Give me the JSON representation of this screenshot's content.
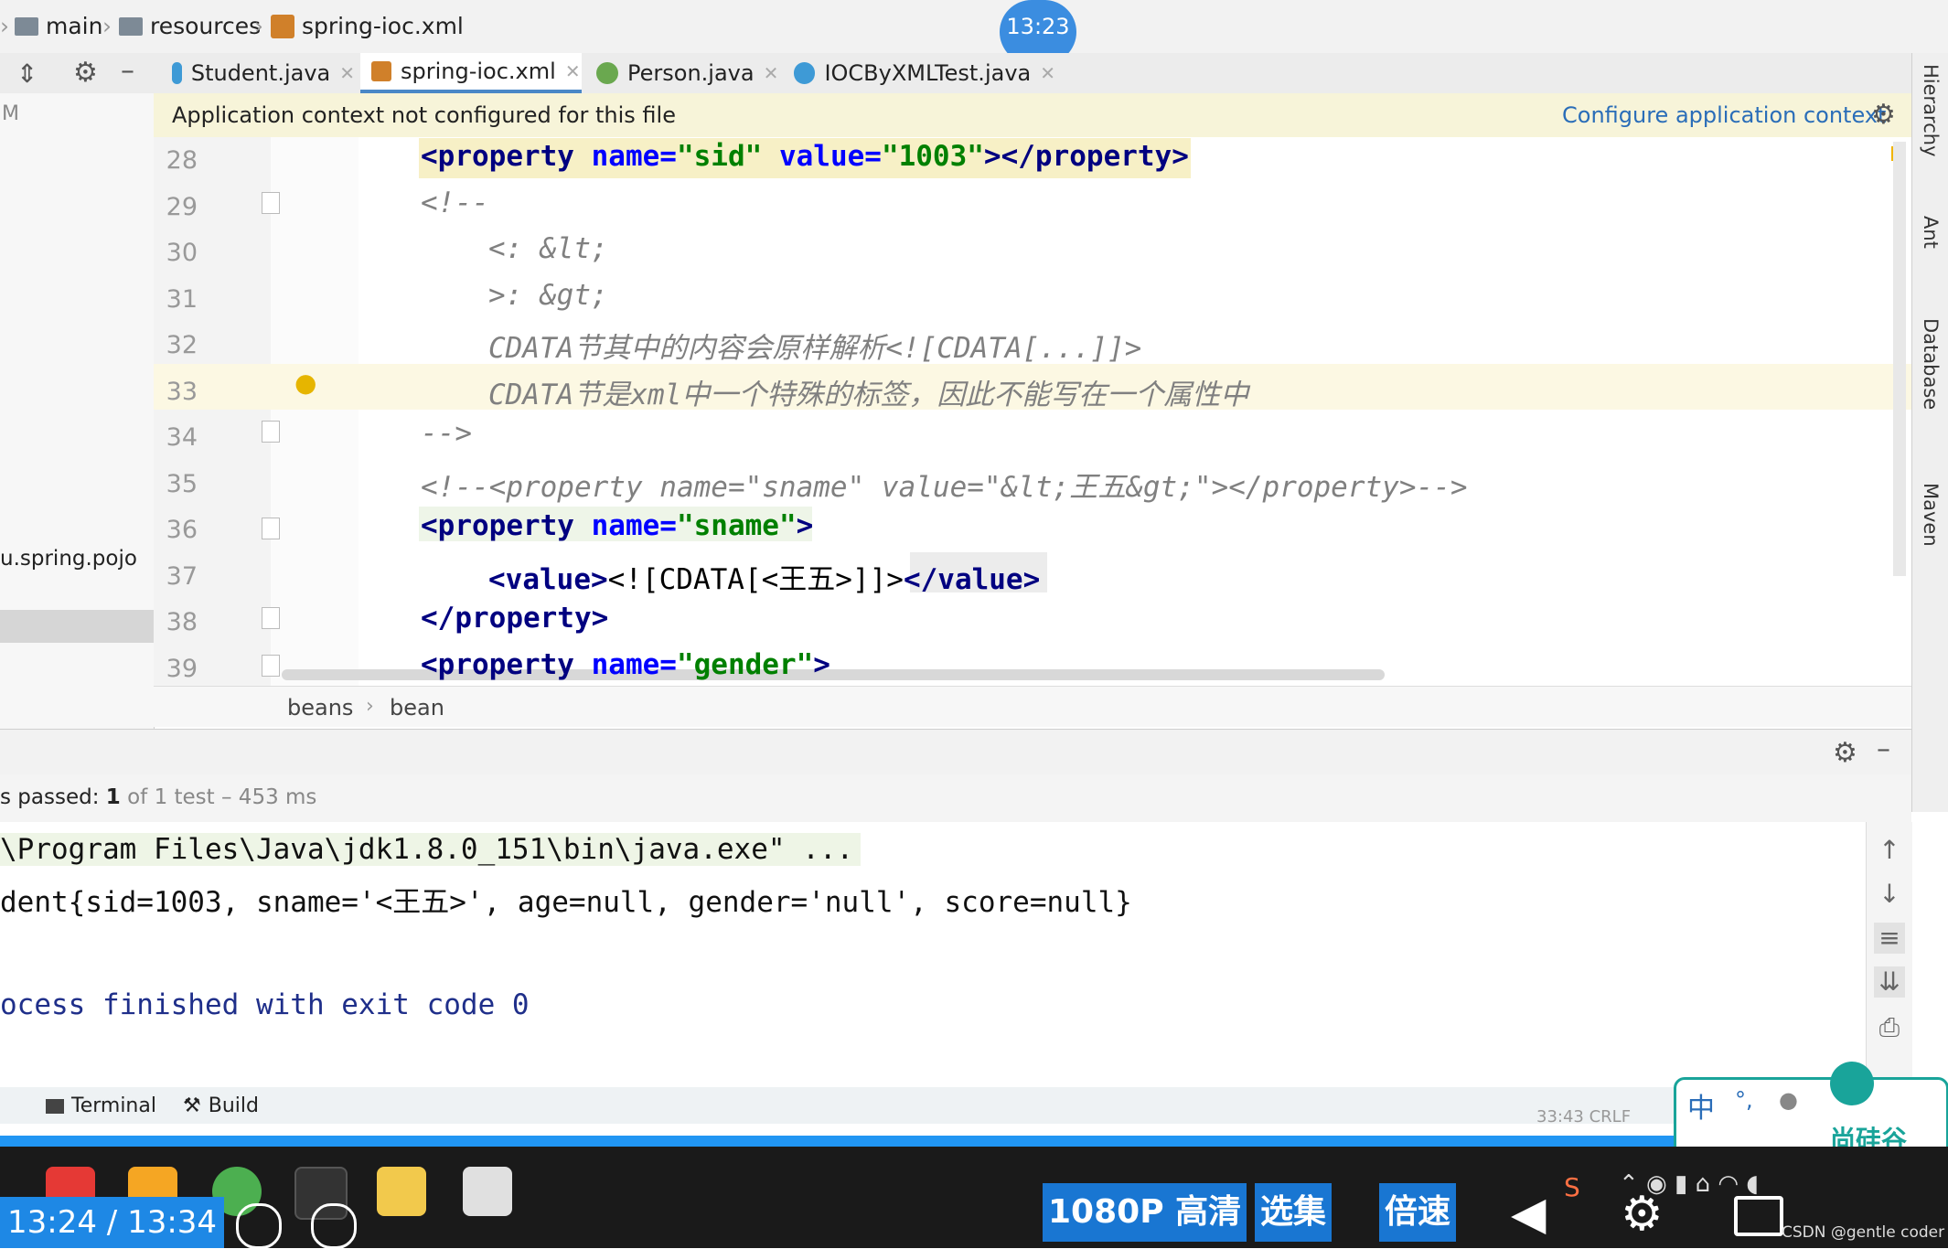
{
  "breadcrumb": {
    "items": [
      "main",
      "resources",
      "spring-ioc.xml"
    ]
  },
  "overlay_clock": "13:23",
  "tabs": [
    {
      "label": "Student.java",
      "icon": "class-icon",
      "active": false
    },
    {
      "label": "spring-ioc.xml",
      "icon": "xml-file-icon",
      "active": true
    },
    {
      "label": "Person.java",
      "icon": "interface-icon",
      "active": false
    },
    {
      "label": "IOCByXMLTest.java",
      "icon": "test-class-icon",
      "active": false
    }
  ],
  "project_panel": {
    "header_fragment": "M",
    "package_label": "u.spring.pojo"
  },
  "notification": {
    "text": "Application context not configured for this file",
    "link": "Configure application context"
  },
  "editor": {
    "lines": [
      {
        "n": "28",
        "parts": [
          {
            "c": "tag",
            "t": "<property "
          },
          {
            "c": "attr",
            "t": "name="
          },
          {
            "c": "val",
            "t": "\"sid\" "
          },
          {
            "c": "attr",
            "t": "value="
          },
          {
            "c": "val",
            "t": "\"1003\""
          },
          {
            "c": "tag",
            "t": "></property>"
          }
        ],
        "indent": 0
      },
      {
        "n": "29",
        "parts": [
          {
            "c": "cmt",
            "t": "<!--"
          }
        ],
        "indent": 0
      },
      {
        "n": "30",
        "parts": [
          {
            "c": "cmt",
            "t": "<: &lt;"
          }
        ],
        "indent": 1
      },
      {
        "n": "31",
        "parts": [
          {
            "c": "cmt",
            "t": ">: &gt;"
          }
        ],
        "indent": 1
      },
      {
        "n": "32",
        "parts": [
          {
            "c": "cmt",
            "t": "CDATA节其中的内容会原样解析<![CDATA[...]]>"
          }
        ],
        "indent": 1
      },
      {
        "n": "33",
        "parts": [
          {
            "c": "cmt",
            "t": "CDATA节是xml中一个特殊的标签，因此不能写在一个属性中"
          }
        ],
        "indent": 1
      },
      {
        "n": "34",
        "parts": [
          {
            "c": "cmt",
            "t": "-->"
          }
        ],
        "indent": 0
      },
      {
        "n": "35",
        "parts": [
          {
            "c": "cmt",
            "t": "<!--<property name=\"sname\" value=\"&lt;王五&gt;\"></property>-->"
          }
        ],
        "indent": 0
      },
      {
        "n": "36",
        "parts": [
          {
            "c": "tag",
            "t": "<property "
          },
          {
            "c": "attr",
            "t": "name="
          },
          {
            "c": "val",
            "t": "\"sname\""
          },
          {
            "c": "tag",
            "t": ">"
          }
        ],
        "indent": 0
      },
      {
        "n": "37",
        "parts": [
          {
            "c": "tag",
            "t": "<value>"
          },
          {
            "c": "txt",
            "t": "<![CDATA[<王五>]]>"
          },
          {
            "c": "tag",
            "t": "</value>"
          }
        ],
        "indent": 1
      },
      {
        "n": "38",
        "parts": [
          {
            "c": "tag",
            "t": "</property>"
          }
        ],
        "indent": 0
      },
      {
        "n": "39",
        "parts": [
          {
            "c": "tag",
            "t": "<property "
          },
          {
            "c": "attr",
            "t": "name="
          },
          {
            "c": "val",
            "t": "\"gender\""
          },
          {
            "c": "tag",
            "t": ">"
          }
        ],
        "indent": 0
      }
    ],
    "crumbs": [
      "beans",
      "bean"
    ]
  },
  "right_tools": [
    "Hierarchy",
    "Ant",
    "Database",
    "Maven"
  ],
  "run": {
    "status_prefix": "s passed: ",
    "passed": "1",
    "status_rest": " of 1 test – 453 ms",
    "console": [
      "\\Program Files\\Java\\jdk1.8.0_151\\bin\\java.exe\" ...",
      "dent{sid=1003, sname='<王五>', age=null, gender='null', score=null}",
      "",
      "ocess finished with exit code 0"
    ]
  },
  "bottom_tools": [
    "Terminal",
    "Build"
  ],
  "status_fragment": "33:43   CRLF",
  "taskbar": {
    "time_current": "13:24",
    "time_sep": "/",
    "time_total": "13:34",
    "quality": "1080P 高清",
    "episodes": "选集",
    "speed": "倍速",
    "watermark": "CSDN @gentle coder"
  },
  "ime": {
    "label_zh": "中",
    "brand": "尚硅谷"
  },
  "colors": {
    "accent": "#2a6db8",
    "notice_bg": "#f7f4d9",
    "progress": "#2196f3",
    "ime_border": "#19a49a"
  }
}
